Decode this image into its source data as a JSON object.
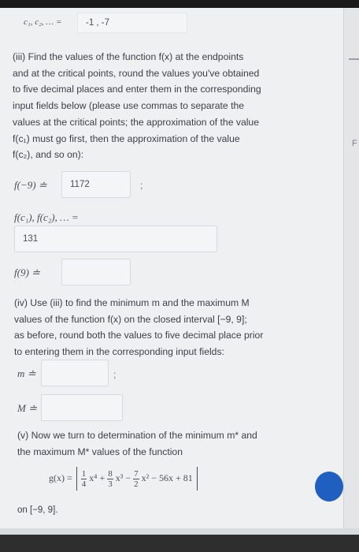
{
  "line0": {
    "label": "c₁, c₂, … =",
    "value": "-1 , -7"
  },
  "part3": {
    "lines": [
      "(iii) Find the values of the function f(x) at the endpoints",
      "and at the critical points, round the values you've obtained",
      "to five decimal places and enter them in the corresponding",
      "input fields below (please use commas to separate the",
      "values at the critical points; the approximation of the value",
      "f(c₁) must go first, then the approximation of the value",
      "f(c₂), and so on):"
    ],
    "f_left_label": "f(−9) ≐",
    "f_left_value": "1172",
    "f_crit_label": "f(c₁), f(c₂), … =",
    "f_crit_value": "131",
    "f_right_label": "f(9) ≐",
    "f_right_value": ""
  },
  "part4": {
    "lines": [
      "(iv) Use (iii) to find the minimum m and the maximum M",
      "values of the function f(x) on the closed interval [−9, 9];",
      "as before, round both the values to five decimal place prior",
      "to entering them in the corresponding input fields:"
    ],
    "m_label": "m ≐",
    "m_value": "",
    "M_label": "M ≐",
    "M_value": ""
  },
  "part5": {
    "lines": [
      "(v) Now we turn to determination of the minimum m* and",
      "the maximum M* values of the function"
    ],
    "g_lhs": "g(x) =",
    "g_t1_num": "1",
    "g_t1_den": "4",
    "g_t1_var": "x⁴ +",
    "g_t2_num": "8",
    "g_t2_den": "3",
    "g_t2_var": "x³ −",
    "g_t3_num": "7",
    "g_t3_den": "2",
    "g_t3_var": "x² − 56x + 81",
    "interval": "on [−9, 9]."
  },
  "sidebar": {
    "letter": "F"
  },
  "colors": {
    "page": "#eef0f1",
    "field": "#f4f5f6",
    "accent": "#1f5fbf"
  }
}
